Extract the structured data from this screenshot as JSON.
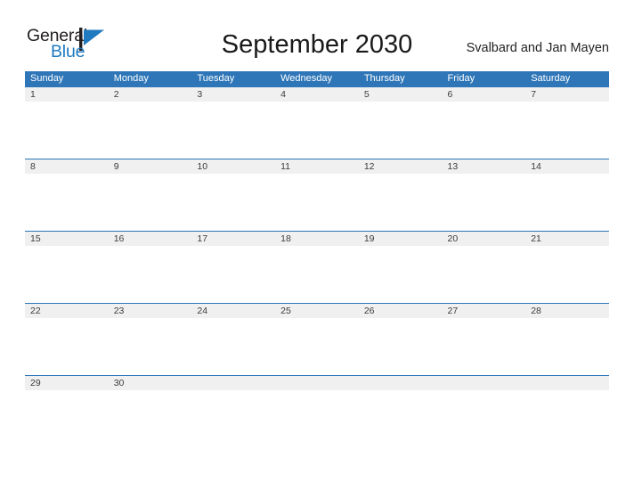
{
  "brand": {
    "line1": "General",
    "line2": "Blue",
    "flag_icon": "blue-flag-triangle",
    "color_text": "#231f20",
    "color_blue": "#1f7ac0"
  },
  "header": {
    "title": "September 2030",
    "region": "Svalbard and Jan Mayen"
  },
  "theme": {
    "header_blue": "#2e76b8",
    "date_band_gray": "#f0f0f0",
    "page_background": "#ffffff"
  },
  "calendar": {
    "weekday_headers": [
      "Sunday",
      "Monday",
      "Tuesday",
      "Wednesday",
      "Thursday",
      "Friday",
      "Saturday"
    ],
    "weeks": [
      {
        "days": [
          "1",
          "2",
          "3",
          "4",
          "5",
          "6",
          "7"
        ]
      },
      {
        "days": [
          "8",
          "9",
          "10",
          "11",
          "12",
          "13",
          "14"
        ]
      },
      {
        "days": [
          "15",
          "16",
          "17",
          "18",
          "19",
          "20",
          "21"
        ]
      },
      {
        "days": [
          "22",
          "23",
          "24",
          "25",
          "26",
          "27",
          "28"
        ]
      },
      {
        "days": [
          "29",
          "30",
          "",
          "",
          "",
          "",
          ""
        ]
      }
    ]
  }
}
